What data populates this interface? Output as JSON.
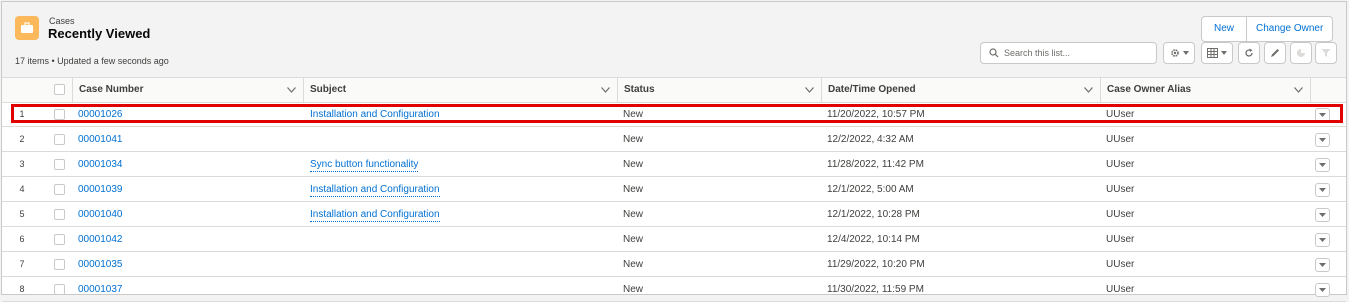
{
  "header": {
    "object_label": "Cases",
    "list_title": "Recently Viewed",
    "meta": "17 items • Updated a few seconds ago",
    "icon": "case-briefcase-icon",
    "icon_color": "#fcb95b"
  },
  "actions": {
    "new_label": "New",
    "change_owner_label": "Change Owner"
  },
  "search": {
    "placeholder": "Search this list..."
  },
  "toolbar_icons": [
    "gear-icon",
    "table-display-icon",
    "refresh-icon",
    "pencil-icon",
    "chart-icon",
    "filter-icon"
  ],
  "table": {
    "columns": [
      "Case Number",
      "Subject",
      "Status",
      "Date/Time Opened",
      "Case Owner Alias"
    ],
    "rows": [
      {
        "num": "1",
        "case": "00001026",
        "subject": "Installation and Configuration",
        "status": "New",
        "opened": "11/20/2022, 10:57 PM",
        "owner": "UUser"
      },
      {
        "num": "2",
        "case": "00001041",
        "subject": "",
        "status": "New",
        "opened": "12/2/2022, 4:32 AM",
        "owner": "UUser"
      },
      {
        "num": "3",
        "case": "00001034",
        "subject": "Sync button functionality",
        "status": "New",
        "opened": "11/28/2022, 11:42 PM",
        "owner": "UUser"
      },
      {
        "num": "4",
        "case": "00001039",
        "subject": "Installation and Configuration",
        "status": "New",
        "opened": "12/1/2022, 5:00 AM",
        "owner": "UUser"
      },
      {
        "num": "5",
        "case": "00001040",
        "subject": "Installation and Configuration",
        "status": "New",
        "opened": "12/1/2022, 10:28 PM",
        "owner": "UUser"
      },
      {
        "num": "6",
        "case": "00001042",
        "subject": "",
        "status": "New",
        "opened": "12/4/2022, 10:14 PM",
        "owner": "UUser"
      },
      {
        "num": "7",
        "case": "00001035",
        "subject": "",
        "status": "New",
        "opened": "11/29/2022, 10:20 PM",
        "owner": "UUser"
      },
      {
        "num": "8",
        "case": "00001037",
        "subject": "",
        "status": "New",
        "opened": "11/30/2022, 11:59 PM",
        "owner": "UUser"
      }
    ]
  },
  "colors": {
    "link": "#0070d2",
    "highlight": "#e00000"
  }
}
